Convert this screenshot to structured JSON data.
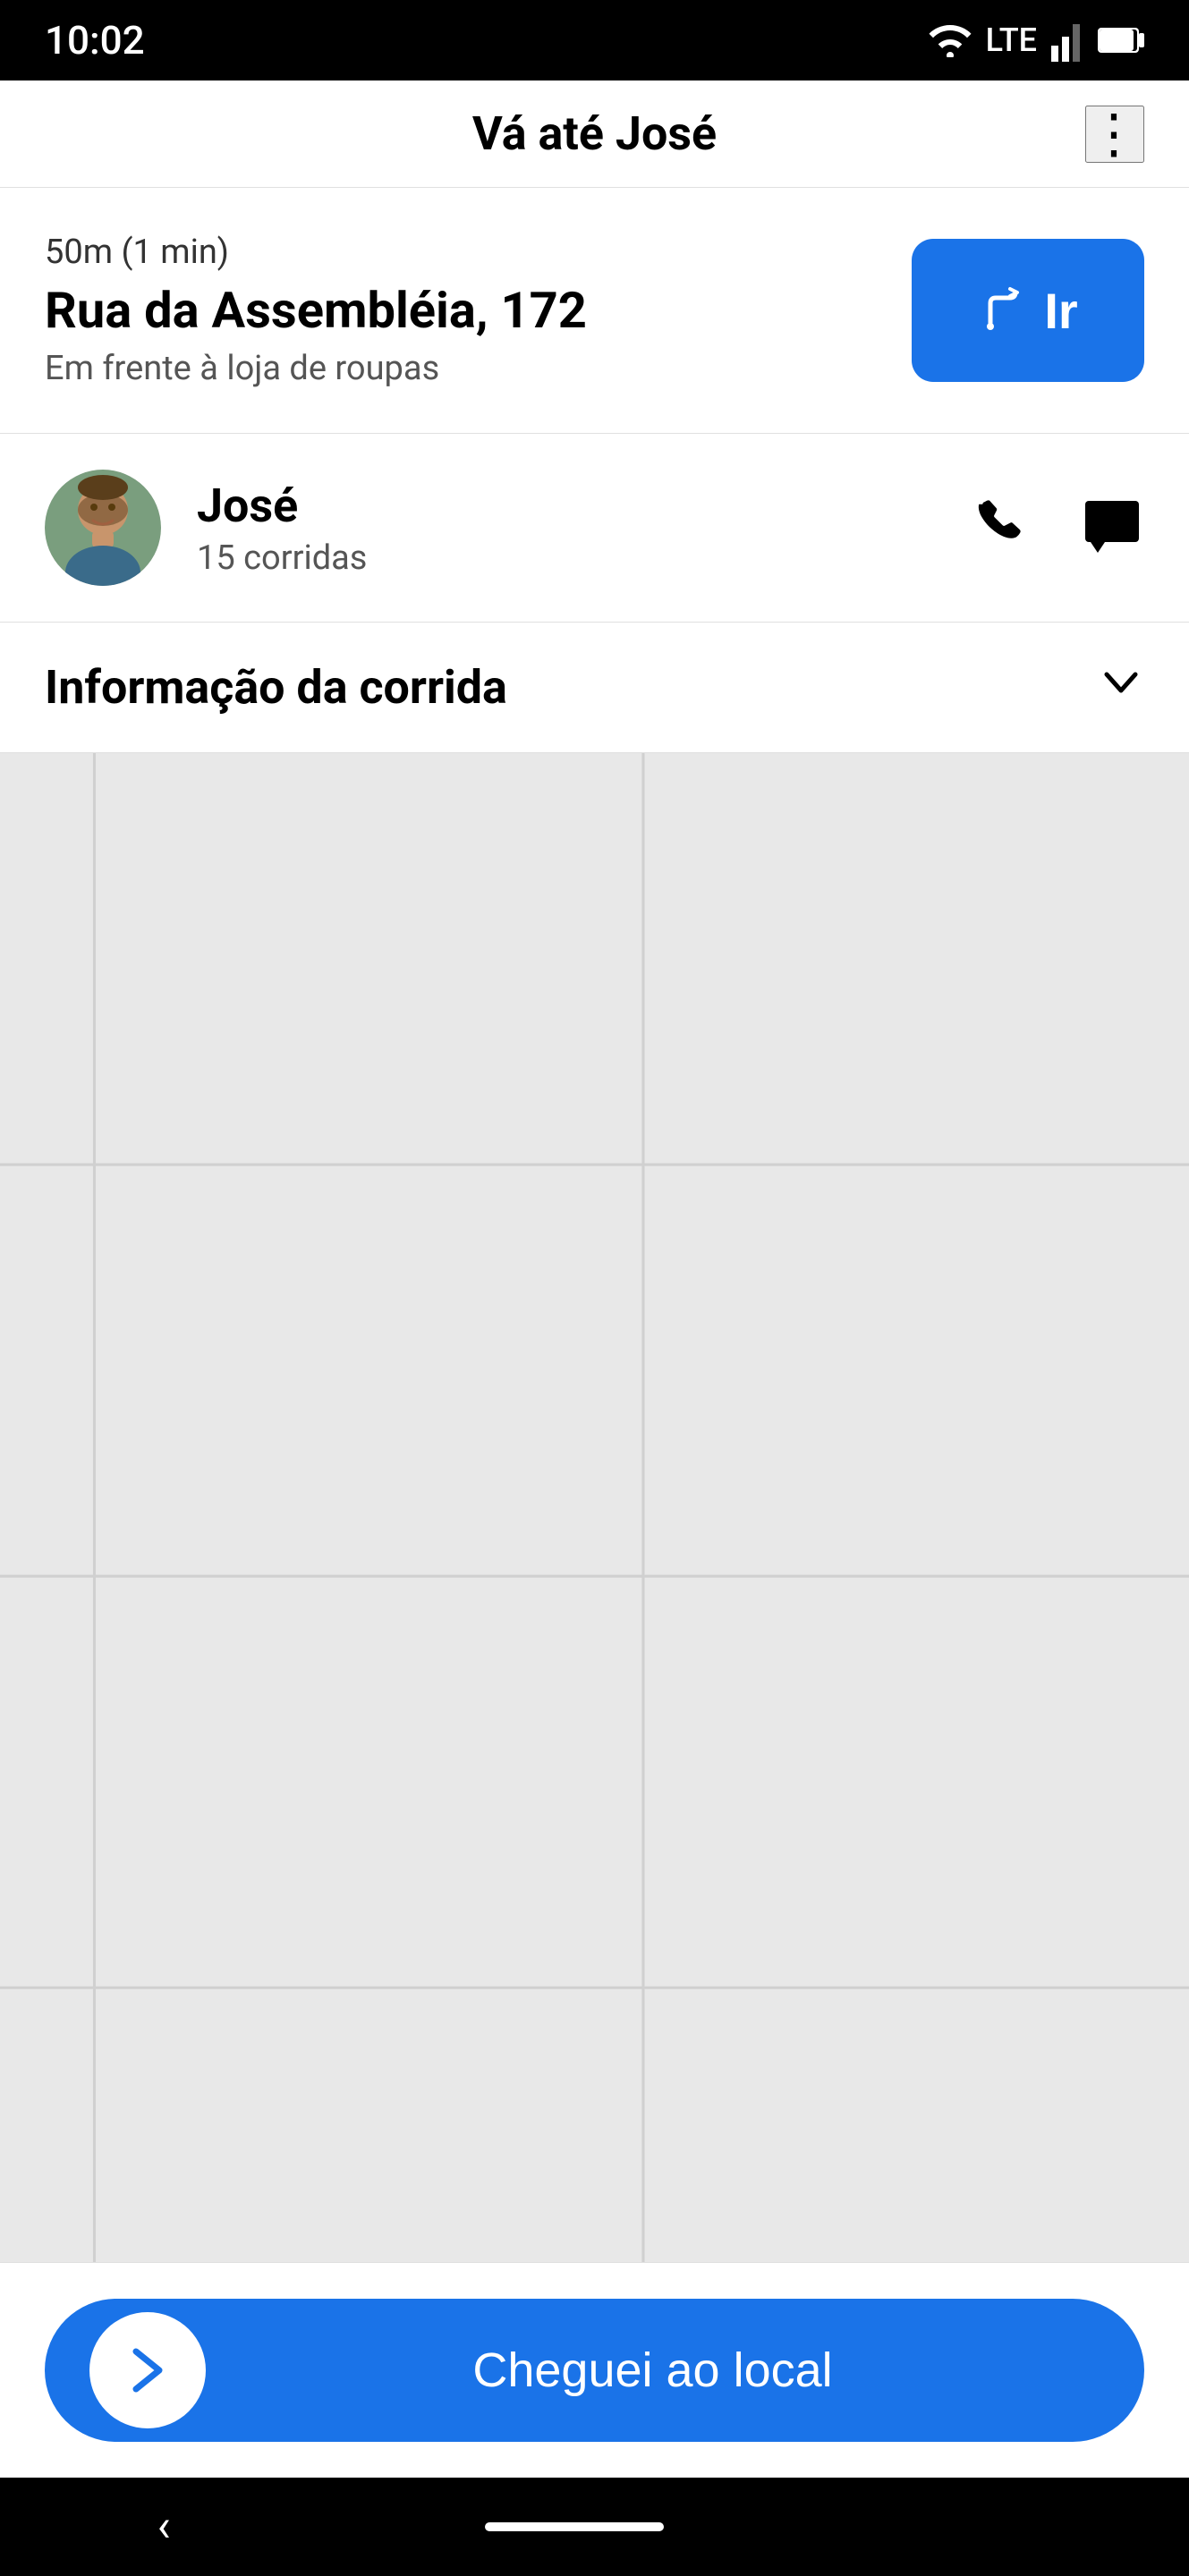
{
  "statusBar": {
    "time": "10:02",
    "lte": "LTE"
  },
  "header": {
    "title": "Vá até José",
    "menuIcon": "⋮"
  },
  "destination": {
    "distance": "50m (1 min)",
    "address": "Rua da Assembléia, 172",
    "hint": "Em frente à loja de roupas",
    "goButton": "Ir"
  },
  "driver": {
    "name": "José",
    "rides": "15 corridas"
  },
  "infoSection": {
    "label": "Informação da corrida"
  },
  "bottomBar": {
    "arrivedLabel": "Cheguei ao local"
  }
}
